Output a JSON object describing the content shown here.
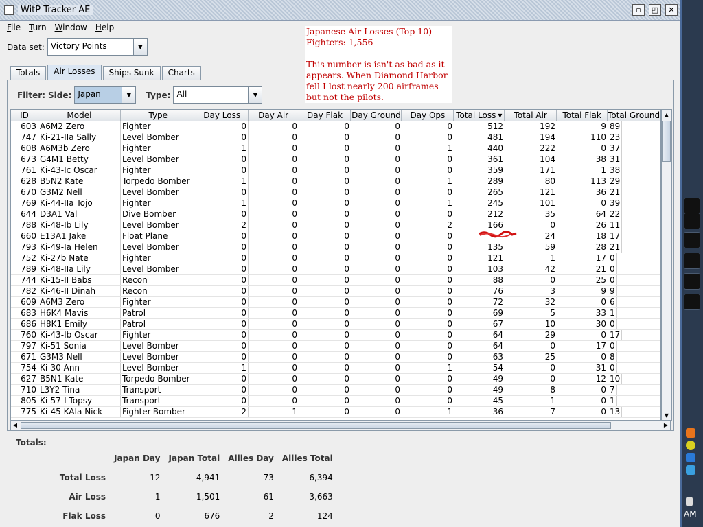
{
  "window": {
    "title": "WitP Tracker AE"
  },
  "menu": [
    {
      "label": "File",
      "key": "F",
      "rest": "ile"
    },
    {
      "label": "Turn",
      "key": "T",
      "rest": "urn"
    },
    {
      "label": "Window",
      "key": "W",
      "rest": "indow"
    },
    {
      "label": "Help",
      "key": "H",
      "rest": "elp"
    }
  ],
  "dataset": {
    "label": "Data set:",
    "value": "Victory Points"
  },
  "tabs": [
    {
      "label": "Totals",
      "active": false
    },
    {
      "label": "Air Losses",
      "active": true
    },
    {
      "label": "Ships Sunk",
      "active": false
    },
    {
      "label": "Charts",
      "active": false
    }
  ],
  "filter": {
    "label": "Filter:",
    "side_label": "Side:",
    "side_value": "Japan",
    "type_label": "Type:",
    "type_value": "All"
  },
  "table": {
    "columns": [
      "ID",
      "Model",
      "Type",
      "Day Loss",
      "Day Air",
      "Day Flak",
      "Day Ground",
      "Day Ops",
      "Total Loss",
      "Total Air",
      "Total Flak",
      "Total Ground"
    ],
    "sort_indicator": "▾",
    "rows": [
      [
        "603",
        "A6M2 Zero",
        "Fighter",
        "0",
        "0",
        "0",
        "0",
        "0",
        "512",
        "192",
        "9",
        "89"
      ],
      [
        "747",
        "Ki-21-IIa Sally",
        "Level Bomber",
        "0",
        "0",
        "0",
        "0",
        "0",
        "481",
        "194",
        "110",
        "23"
      ],
      [
        "608",
        "A6M3b Zero",
        "Fighter",
        "1",
        "0",
        "0",
        "0",
        "1",
        "440",
        "222",
        "0",
        "37"
      ],
      [
        "673",
        "G4M1 Betty",
        "Level Bomber",
        "0",
        "0",
        "0",
        "0",
        "0",
        "361",
        "104",
        "38",
        "31"
      ],
      [
        "761",
        "Ki-43-Ic Oscar",
        "Fighter",
        "0",
        "0",
        "0",
        "0",
        "0",
        "359",
        "171",
        "1",
        "38"
      ],
      [
        "628",
        "B5N2 Kate",
        "Torpedo Bomber",
        "1",
        "0",
        "0",
        "0",
        "1",
        "289",
        "80",
        "113",
        "29"
      ],
      [
        "670",
        "G3M2 Nell",
        "Level Bomber",
        "0",
        "0",
        "0",
        "0",
        "0",
        "265",
        "121",
        "36",
        "21"
      ],
      [
        "769",
        "Ki-44-IIa Tojo",
        "Fighter",
        "1",
        "0",
        "0",
        "0",
        "1",
        "245",
        "101",
        "0",
        "39"
      ],
      [
        "644",
        "D3A1 Val",
        "Dive Bomber",
        "0",
        "0",
        "0",
        "0",
        "0",
        "212",
        "35",
        "64",
        "22"
      ],
      [
        "788",
        "Ki-48-Ib Lily",
        "Level Bomber",
        "2",
        "0",
        "0",
        "0",
        "2",
        "166",
        "0",
        "26",
        "11"
      ],
      [
        "660",
        "E13A1 Jake",
        "Float Plane",
        "0",
        "0",
        "0",
        "0",
        "0",
        "",
        "24",
        "18",
        "17"
      ],
      [
        "793",
        "Ki-49-Ia Helen",
        "Level Bomber",
        "0",
        "0",
        "0",
        "0",
        "0",
        "135",
        "59",
        "28",
        "21"
      ],
      [
        "752",
        "Ki-27b Nate",
        "Fighter",
        "0",
        "0",
        "0",
        "0",
        "0",
        "121",
        "1",
        "17",
        "0"
      ],
      [
        "789",
        "Ki-48-IIa Lily",
        "Level Bomber",
        "0",
        "0",
        "0",
        "0",
        "0",
        "103",
        "42",
        "21",
        "0"
      ],
      [
        "744",
        "Ki-15-II Babs",
        "Recon",
        "0",
        "0",
        "0",
        "0",
        "0",
        "88",
        "0",
        "25",
        "0"
      ],
      [
        "782",
        "Ki-46-II Dinah",
        "Recon",
        "0",
        "0",
        "0",
        "0",
        "0",
        "76",
        "3",
        "9",
        "9"
      ],
      [
        "609",
        "A6M3 Zero",
        "Fighter",
        "0",
        "0",
        "0",
        "0",
        "0",
        "72",
        "32",
        "0",
        "6"
      ],
      [
        "683",
        "H6K4 Mavis",
        "Patrol",
        "0",
        "0",
        "0",
        "0",
        "0",
        "69",
        "5",
        "33",
        "1"
      ],
      [
        "686",
        "H8K1 Emily",
        "Patrol",
        "0",
        "0",
        "0",
        "0",
        "0",
        "67",
        "10",
        "30",
        "0"
      ],
      [
        "760",
        "Ki-43-Ib Oscar",
        "Fighter",
        "0",
        "0",
        "0",
        "0",
        "0",
        "64",
        "29",
        "0",
        "17"
      ],
      [
        "797",
        "Ki-51 Sonia",
        "Level Bomber",
        "0",
        "0",
        "0",
        "0",
        "0",
        "64",
        "0",
        "17",
        "0"
      ],
      [
        "671",
        "G3M3 Nell",
        "Level Bomber",
        "0",
        "0",
        "0",
        "0",
        "0",
        "63",
        "25",
        "0",
        "8"
      ],
      [
        "754",
        "Ki-30 Ann",
        "Level Bomber",
        "1",
        "0",
        "0",
        "0",
        "1",
        "54",
        "0",
        "31",
        "0"
      ],
      [
        "627",
        "B5N1 Kate",
        "Torpedo Bomber",
        "0",
        "0",
        "0",
        "0",
        "0",
        "49",
        "0",
        "12",
        "10"
      ],
      [
        "710",
        "L3Y2 Tina",
        "Transport",
        "0",
        "0",
        "0",
        "0",
        "0",
        "49",
        "8",
        "0",
        "7"
      ],
      [
        "805",
        "Ki-57-I Topsy",
        "Transport",
        "0",
        "0",
        "0",
        "0",
        "0",
        "45",
        "1",
        "0",
        "1"
      ],
      [
        "775",
        "Ki-45 KAIa Nick",
        "Fighter-Bomber",
        "2",
        "1",
        "0",
        "0",
        "1",
        "36",
        "7",
        "0",
        "13"
      ]
    ]
  },
  "totals": {
    "label": "Totals:",
    "columns": [
      "Japan Day",
      "Japan Total",
      "Allies Day",
      "Allies Total"
    ],
    "rows": [
      {
        "label": "Total Loss",
        "values": [
          "12",
          "4,941",
          "73",
          "6,394"
        ]
      },
      {
        "label": "Air Loss",
        "values": [
          "1",
          "1,501",
          "61",
          "3,663"
        ]
      },
      {
        "label": "Flak Loss",
        "values": [
          "0",
          "676",
          "2",
          "124"
        ]
      }
    ]
  },
  "annotation": {
    "line1": "Japanese Air Losses (Top 10)",
    "line2": "Fighters:  1,556",
    "line3": "This number is isn't as bad as it appears.  When Diamond Harbor fell I lost nearly 200 airframes but not the pilots."
  },
  "desktop": {
    "clock_suffix": "AM"
  },
  "colors": {
    "annotation_red": "#c00000",
    "selected_combo": "#b8cfe5",
    "title_stripe": "#b8c6d6"
  }
}
